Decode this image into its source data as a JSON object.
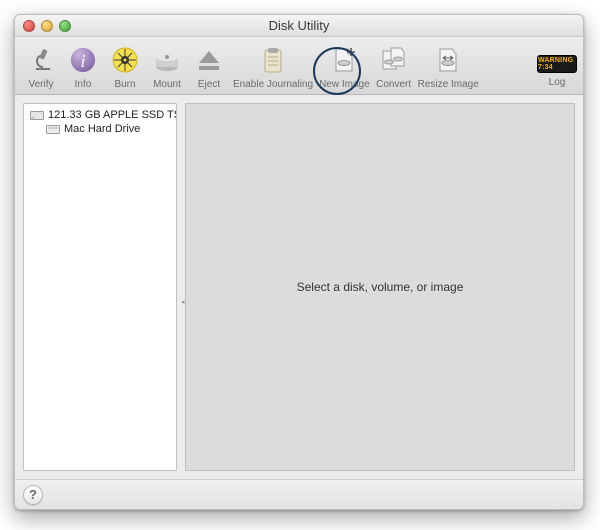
{
  "window": {
    "title": "Disk Utility"
  },
  "toolbar": {
    "verify": {
      "label": "Verify",
      "icon": "microscope-icon"
    },
    "info": {
      "label": "Info",
      "icon": "info-icon"
    },
    "burn": {
      "label": "Burn",
      "icon": "burn-icon"
    },
    "mount": {
      "label": "Mount",
      "icon": "mount-icon"
    },
    "eject": {
      "label": "Eject",
      "icon": "eject-icon"
    },
    "journal": {
      "label": "Enable Journaling",
      "icon": "clipboard-icon"
    },
    "newimage": {
      "label": "New Image",
      "icon": "new-image-icon"
    },
    "convert": {
      "label": "Convert",
      "icon": "convert-icon"
    },
    "resize": {
      "label": "Resize Image",
      "icon": "resize-image-icon"
    },
    "log": {
      "label": "Log",
      "chip_text": "WARNING 7:34"
    }
  },
  "sidebar": {
    "disk": {
      "label": "121.33 GB APPLE SSD TS..."
    },
    "volume": {
      "label": "Mac Hard Drive"
    }
  },
  "main": {
    "placeholder": "Select a disk, volume, or image"
  },
  "footer": {
    "help_label": "?"
  },
  "annotation": {
    "new_image_highlighted": true
  }
}
